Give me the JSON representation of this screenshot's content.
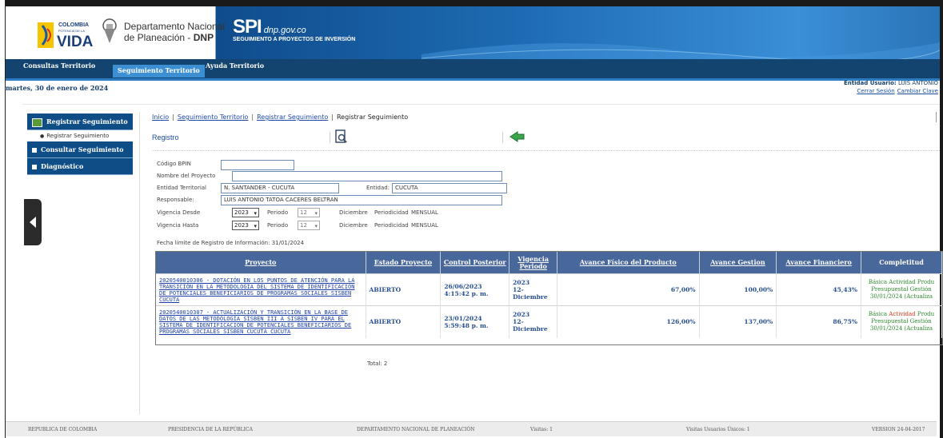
{
  "header": {
    "colombia_brand_line1": "COLOMBIA",
    "colombia_brand_line2": "POTENCIA DE LA",
    "colombia_brand_word": "VIDA",
    "dnp_line1": "Departamento Nacional",
    "dnp_line2": "de Planeación - ",
    "dnp_bold": "DNP",
    "spi": "SPI",
    "spi_site": "dnp.gov.co",
    "spi_sub": "SEGUIMIENTO A PROYECTOS DE INVERSIÓN"
  },
  "nav": {
    "items": [
      {
        "label": "Consultas Territorio"
      },
      {
        "label": "Seguimiento Territorio"
      },
      {
        "label": "Ayuda Territorio"
      }
    ]
  },
  "date": "martes, 30 de enero de 2024",
  "user": {
    "label": "Entidad Usuario:",
    "name": "LUIS ANTONIO",
    "logout": "Cerrar Sesión",
    "change_password": "Cambiar Clave"
  },
  "sidebar": {
    "registrar": "Registrar Seguimiento",
    "registrar_sub": "Registrar Seguimiento",
    "consultar": "Consultar Seguimiento",
    "diagnostico": "Diagnóstico"
  },
  "breadcrumb": {
    "inicio": "Inicio",
    "seguimiento": "Seguimiento Territorio",
    "registrar": "Registrar Seguimiento",
    "current": "Registrar Seguimiento"
  },
  "section_title": "Registro",
  "form": {
    "codigo_label": "Código BPIN",
    "codigo_value": "",
    "nombre_label": "Nombre del Proyecto",
    "nombre_value": "",
    "entidad_territorial_label": "Entidad Territorial",
    "entidad_territorial_value": "N. SANTANDER - CUCUTA",
    "entidad_label": "Entidad:",
    "entidad_value": "CUCUTA",
    "responsable_label": "Responsable:",
    "responsable_value": "LUIS ANTONIO TATOA CACERES BELTRAN",
    "vig_desde_label": "Vigencia Desde",
    "vig_desde_value": "2023",
    "periodo_label": "Periodo",
    "periodo_value": "12",
    "mes": "Diciembre",
    "periodicidad_label": "Periodicidad",
    "periodicidad_value": "MENSUAL",
    "vig_hasta_label": "Vigencia Hasta",
    "vig_hasta_value": "2023",
    "periodo2_value": "12",
    "mes2": "Diciembre",
    "periodicidad2_value": "MENSUAL"
  },
  "fecha_limite": "Fecha límite de Registro de Información:   31/01/2024",
  "table": {
    "headers": {
      "proyecto": "Proyecto",
      "estado": "Estado Proyecto",
      "control": "Control Posterior",
      "vigencia_1": "Vigencia",
      "vigencia_2": "Periodo",
      "fisico": "Avance Físico del Producto",
      "gestion": "Avance Gestion",
      "financiero": "Avance Financiero",
      "completitud": "Completitud"
    },
    "rows": [
      {
        "proyecto": "2020540010306 - DOTACIÓN EN LOS PUNTOS DE ATENCIÓN PARA LA TRANSICIÓN EN LA METODOLOGÍA DEL SISTEMA DE IDENTIFICACIÓN DE POTENCIALES BENEFICIARIOS DE PROGRAMAS SOCIALES SISBEN CUCUTA",
        "estado": "ABIERTO",
        "control_fecha": "26/06/2023",
        "control_hora": "4:15:42 p. m.",
        "vig_year": "2023",
        "vig_num": "12-",
        "vig_mes": "Diciembre",
        "fisico": "67,00%",
        "gestion": "100,00%",
        "financiero": "45,43%",
        "comp_line1_a": "Básica Actividad Produ",
        "comp_line1_red": "",
        "comp_line2": "Presupuestal Gestión",
        "comp_line3": "30/01/2024 (Actualiza"
      },
      {
        "proyecto": "2020540010307 - ACTUALIZACIÓN Y TRANSICIÓN EN LA BASE DE DATOS DE LAS METODOLOGÍA SISBEN III A SISBEN IV PARA EL SISTEMA DE IDENTIFICACIÓN DE POTENCIALES BENEFICIARIOS DE PROGRAMAS SOCIALES SISBEN CUCUTA CUCUTA",
        "estado": "ABIERTO",
        "control_fecha": "23/01/2024",
        "control_hora": "5:59:48 p. m.",
        "vig_year": "2023",
        "vig_num": "12-",
        "vig_mes": "Diciembre",
        "fisico": "126,00%",
        "gestion": "137,00%",
        "financiero": "86,75%",
        "comp_line1_a": "Básica ",
        "comp_line1_red": "Actividad",
        "comp_line1_b": " Produ",
        "comp_line2": "Presupuestal Gestión",
        "comp_line3": "30/01/2024 (Actualiza"
      }
    ]
  },
  "total": "Total: 2",
  "footer": {
    "republica": "REPUBLICA DE COLOMBIA",
    "presidencia": "PRESIDENCIA DE LA REPÚBLICA",
    "dnp": "DEPARTAMENTO NACIONAL DE PLANEACIÓN",
    "visitas": "Visitas: 1",
    "visitas_unicas": "Visitas Usuarios Únicos: 1",
    "version": "VERSION 24-04-2017"
  },
  "colors": {
    "nav_bg": "#13446f",
    "header_blue": "#1e6bb3",
    "table_header": "#48679a",
    "link": "#1d3fa8",
    "complete_green": "#2e8a2e"
  }
}
